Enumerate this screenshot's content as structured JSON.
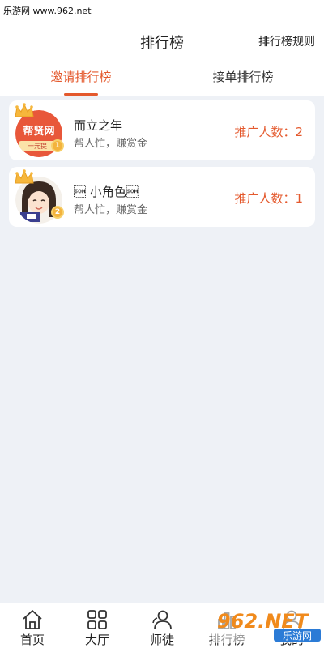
{
  "watermark_top": "乐游网 www.962.net",
  "header": {
    "title": "排行榜",
    "rules_label": "排行榜规则"
  },
  "tabs": [
    {
      "label": "邀请排行榜",
      "active": true
    },
    {
      "label": "接单排行榜",
      "active": false
    }
  ],
  "ranking": [
    {
      "rank": "1",
      "name": "而立之年",
      "subtitle": "帮人忙，赚赏金",
      "count": "推广人数：2",
      "avatar_text": "帮贤网",
      "avatar_banner": "一元提"
    },
    {
      "rank": "2",
      "name": "\u0001 小角色\u0001",
      "subtitle": "帮人忙，赚赏金",
      "count": "推广人数：1"
    }
  ],
  "bottom_nav": [
    {
      "label": "首页",
      "icon": "home-icon"
    },
    {
      "label": "大厅",
      "icon": "grid-icon"
    },
    {
      "label": "师徒",
      "icon": "people-icon"
    },
    {
      "label": "排行榜",
      "icon": "ranking-icon"
    },
    {
      "label": "我的",
      "icon": "user-icon"
    }
  ],
  "watermark_bottom": {
    "brand": "962.NET",
    "sub": "乐游网"
  },
  "colors": {
    "accent": "#e4592d",
    "background": "#eef1f6"
  }
}
